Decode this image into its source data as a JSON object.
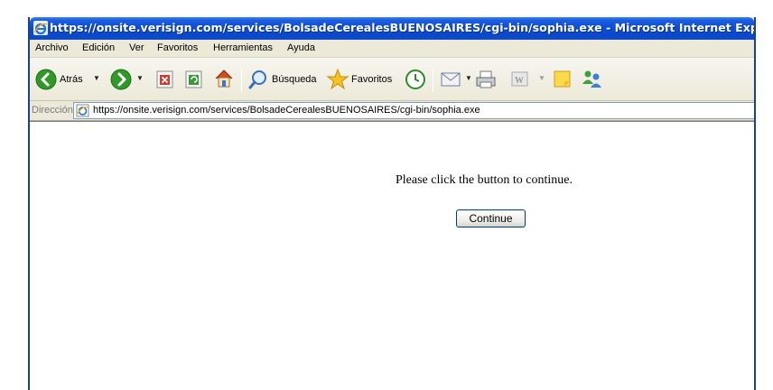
{
  "window": {
    "title": "https://onsite.verisign.com/services/BolsadeCerealesBUENOSAIRES/cgi-bin/sophia.exe - Microsoft Internet Explorer"
  },
  "menu": {
    "items": [
      "Archivo",
      "Edición",
      "Ver",
      "Favoritos",
      "Herramientas",
      "Ayuda"
    ]
  },
  "toolbar": {
    "back_label": "Atrás",
    "search_label": "Búsqueda",
    "favorites_label": "Favoritos"
  },
  "address": {
    "label": "Dirección",
    "url": "https://onsite.verisign.com/services/BolsadeCerealesBUENOSAIRES/cgi-bin/sophia.exe"
  },
  "page": {
    "message": "Please click the button to continue.",
    "button_label": "Continue"
  },
  "colors": {
    "titlebar": "#0a48cc",
    "chrome": "#ece9d8",
    "back_button": "#2f9a27"
  }
}
